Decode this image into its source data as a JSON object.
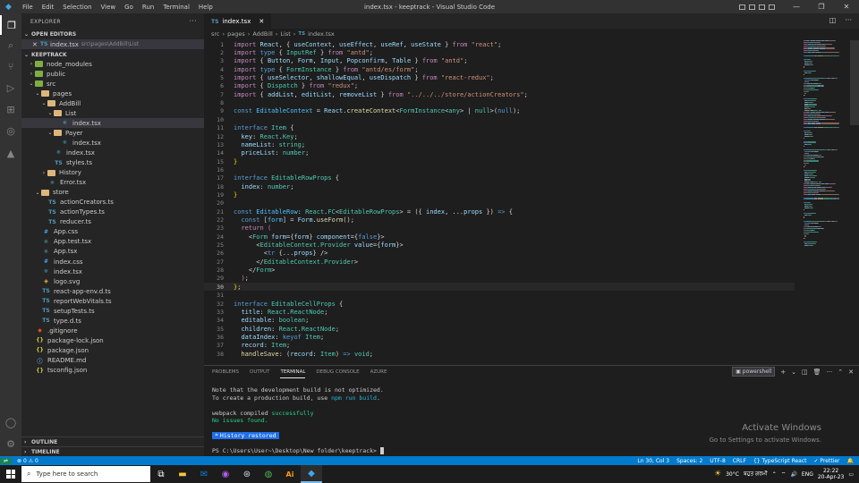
{
  "window": {
    "title": "index.tsx - keeptrack - Visual Studio Code",
    "menu": [
      "File",
      "Edit",
      "Selection",
      "View",
      "Go",
      "Run",
      "Terminal",
      "Help"
    ]
  },
  "sidebar": {
    "header": "EXPLORER",
    "open_editors_label": "OPEN EDITORS",
    "open_editor": {
      "icon": "TS",
      "name": "index.tsx",
      "path": "src\\pages\\AddBill\\List"
    },
    "project_label": "KEEPTRACK",
    "tree": [
      {
        "label": "node_modules",
        "type": "folder",
        "indent": 1,
        "open": false,
        "color": "green"
      },
      {
        "label": "public",
        "type": "folder",
        "indent": 1,
        "open": false,
        "color": "green"
      },
      {
        "label": "src",
        "type": "folder",
        "indent": 1,
        "open": true,
        "color": "green"
      },
      {
        "label": "pages",
        "type": "folder",
        "indent": 2,
        "open": true,
        "color": "orange"
      },
      {
        "label": "AddBill",
        "type": "folder",
        "indent": 3,
        "open": true,
        "color": "orange"
      },
      {
        "label": "List",
        "type": "folder",
        "indent": 4,
        "open": true,
        "color": "orange"
      },
      {
        "label": "index.tsx",
        "type": "tsx",
        "indent": 5,
        "selected": true
      },
      {
        "label": "Payer",
        "type": "folder",
        "indent": 4,
        "open": true,
        "color": "orange"
      },
      {
        "label": "index.tsx",
        "type": "tsx",
        "indent": 5
      },
      {
        "label": "index.tsx",
        "type": "tsx",
        "indent": 4
      },
      {
        "label": "styles.ts",
        "type": "ts",
        "indent": 4
      },
      {
        "label": "History",
        "type": "folder",
        "indent": 3,
        "open": false,
        "color": "orange"
      },
      {
        "label": "Error.tsx",
        "type": "tsx",
        "indent": 3
      },
      {
        "label": "store",
        "type": "folder",
        "indent": 2,
        "open": true,
        "color": "orange"
      },
      {
        "label": "actionCreators.ts",
        "type": "ts",
        "indent": 3
      },
      {
        "label": "actionTypes.ts",
        "type": "ts",
        "indent": 3
      },
      {
        "label": "reducer.ts",
        "type": "ts",
        "indent": 3
      },
      {
        "label": "App.css",
        "type": "css",
        "indent": 2
      },
      {
        "label": "App.test.tsx",
        "type": "tsx",
        "indent": 2
      },
      {
        "label": "App.tsx",
        "type": "tsx",
        "indent": 2
      },
      {
        "label": "index.css",
        "type": "css",
        "indent": 2
      },
      {
        "label": "index.tsx",
        "type": "tsx",
        "indent": 2
      },
      {
        "label": "logo.svg",
        "type": "svg",
        "indent": 2
      },
      {
        "label": "react-app-env.d.ts",
        "type": "ts",
        "indent": 2
      },
      {
        "label": "reportWebVitals.ts",
        "type": "ts",
        "indent": 2
      },
      {
        "label": "setupTests.ts",
        "type": "ts",
        "indent": 2
      },
      {
        "label": "type.d.ts",
        "type": "ts",
        "indent": 2
      },
      {
        "label": ".gitignore",
        "type": "git",
        "indent": 1
      },
      {
        "label": "package-lock.json",
        "type": "json",
        "indent": 1
      },
      {
        "label": "package.json",
        "type": "json",
        "indent": 1
      },
      {
        "label": "README.md",
        "type": "md",
        "indent": 1
      },
      {
        "label": "tsconfig.json",
        "type": "json",
        "indent": 1
      }
    ],
    "outline_label": "OUTLINE",
    "timeline_label": "TIMELINE"
  },
  "editor": {
    "tab": {
      "icon": "TS",
      "name": "index.tsx"
    },
    "breadcrumb": [
      "src",
      "pages",
      "AddBill",
      "List",
      "index.tsx"
    ],
    "breadcrumb_icon": "TS",
    "current_line": 30,
    "lines": [
      [
        [
          "k",
          "import "
        ],
        [
          "v",
          "React"
        ],
        [
          "p",
          ", { "
        ],
        [
          "v",
          "useContext"
        ],
        [
          "p",
          ", "
        ],
        [
          "v",
          "useEffect"
        ],
        [
          "p",
          ", "
        ],
        [
          "v",
          "useRef"
        ],
        [
          "p",
          ", "
        ],
        [
          "v",
          "useState"
        ],
        [
          "p",
          " } "
        ],
        [
          "k",
          "from "
        ],
        [
          "s",
          "\"react\""
        ],
        [
          "p",
          ";"
        ]
      ],
      [
        [
          "k",
          "import "
        ],
        [
          "kb",
          "type "
        ],
        [
          "p",
          "{ "
        ],
        [
          "t",
          "InputRef"
        ],
        [
          "p",
          " } "
        ],
        [
          "k",
          "from "
        ],
        [
          "s",
          "\"antd\""
        ],
        [
          "p",
          ";"
        ]
      ],
      [
        [
          "k",
          "import "
        ],
        [
          "p",
          "{ "
        ],
        [
          "v",
          "Button"
        ],
        [
          "p",
          ", "
        ],
        [
          "v",
          "Form"
        ],
        [
          "p",
          ", "
        ],
        [
          "v",
          "Input"
        ],
        [
          "p",
          ", "
        ],
        [
          "v",
          "Popconfirm"
        ],
        [
          "p",
          ", "
        ],
        [
          "v",
          "Table"
        ],
        [
          "p",
          " } "
        ],
        [
          "k",
          "from "
        ],
        [
          "s",
          "\"antd\""
        ],
        [
          "p",
          ";"
        ]
      ],
      [
        [
          "k",
          "import "
        ],
        [
          "kb",
          "type "
        ],
        [
          "p",
          "{ "
        ],
        [
          "t",
          "FormInstance"
        ],
        [
          "p",
          " } "
        ],
        [
          "k",
          "from "
        ],
        [
          "s",
          "\"antd/es/form\""
        ],
        [
          "p",
          ";"
        ]
      ],
      [
        [
          "k",
          "import "
        ],
        [
          "p",
          "{ "
        ],
        [
          "v",
          "useSelector"
        ],
        [
          "p",
          ", "
        ],
        [
          "v",
          "shallowEqual"
        ],
        [
          "p",
          ", "
        ],
        [
          "v",
          "useDispatch"
        ],
        [
          "p",
          " } "
        ],
        [
          "k",
          "from "
        ],
        [
          "s",
          "\"react-redux\""
        ],
        [
          "p",
          ";"
        ]
      ],
      [
        [
          "k",
          "import "
        ],
        [
          "p",
          "{ "
        ],
        [
          "t",
          "Dispatch"
        ],
        [
          "p",
          " } "
        ],
        [
          "k",
          "from "
        ],
        [
          "s",
          "\"redux\""
        ],
        [
          "p",
          ";"
        ]
      ],
      [
        [
          "k",
          "import "
        ],
        [
          "p",
          "{ "
        ],
        [
          "v",
          "addList"
        ],
        [
          "p",
          ", "
        ],
        [
          "v",
          "editList"
        ],
        [
          "p",
          ", "
        ],
        [
          "v",
          "removeList"
        ],
        [
          "p",
          " } "
        ],
        [
          "k",
          "from "
        ],
        [
          "s",
          "\"../../../store/actionCreators\""
        ],
        [
          "p",
          ";"
        ]
      ],
      [],
      [
        [
          "kb",
          "const "
        ],
        [
          "c",
          "EditableContext"
        ],
        [
          "p",
          " = "
        ],
        [
          "v",
          "React"
        ],
        [
          "p",
          "."
        ],
        [
          "f",
          "createContext"
        ],
        [
          "p",
          "<"
        ],
        [
          "t",
          "FormInstance"
        ],
        [
          "p",
          "<"
        ],
        [
          "t",
          "any"
        ],
        [
          "p",
          "> | "
        ],
        [
          "t",
          "null"
        ],
        [
          "p",
          ">("
        ],
        [
          "kb",
          "null"
        ],
        [
          "p",
          ");"
        ]
      ],
      [],
      [
        [
          "kb",
          "interface "
        ],
        [
          "t",
          "Item"
        ],
        [
          "p",
          " {"
        ]
      ],
      [
        [
          "p",
          "  "
        ],
        [
          "v",
          "key"
        ],
        [
          "p",
          ": "
        ],
        [
          "t",
          "React"
        ],
        [
          "p",
          "."
        ],
        [
          "t",
          "Key"
        ],
        [
          "p",
          ";"
        ]
      ],
      [
        [
          "p",
          "  "
        ],
        [
          "v",
          "nameList"
        ],
        [
          "p",
          ": "
        ],
        [
          "t",
          "string"
        ],
        [
          "p",
          ";"
        ]
      ],
      [
        [
          "p",
          "  "
        ],
        [
          "v",
          "priceList"
        ],
        [
          "p",
          ": "
        ],
        [
          "t",
          "number"
        ],
        [
          "p",
          ";"
        ]
      ],
      [
        [
          "br",
          "}"
        ]
      ],
      [],
      [
        [
          "kb",
          "interface "
        ],
        [
          "t",
          "EditableRowProps"
        ],
        [
          "p",
          " {"
        ]
      ],
      [
        [
          "p",
          "  "
        ],
        [
          "v",
          "index"
        ],
        [
          "p",
          ": "
        ],
        [
          "t",
          "number"
        ],
        [
          "p",
          ";"
        ]
      ],
      [
        [
          "br",
          "}"
        ]
      ],
      [],
      [
        [
          "kb",
          "const "
        ],
        [
          "c",
          "EditableRow"
        ],
        [
          "p",
          ": "
        ],
        [
          "t",
          "React"
        ],
        [
          "p",
          "."
        ],
        [
          "t",
          "FC"
        ],
        [
          "p",
          "<"
        ],
        [
          "t",
          "EditableRowProps"
        ],
        [
          "p",
          "> = ({ "
        ],
        [
          "v",
          "index"
        ],
        [
          "p",
          ", ..."
        ],
        [
          "v",
          "props"
        ],
        [
          "p",
          " }) "
        ],
        [
          "kb",
          "=>"
        ],
        [
          "p",
          " {"
        ]
      ],
      [
        [
          "p",
          "  "
        ],
        [
          "kb",
          "const "
        ],
        [
          "p",
          "["
        ],
        [
          "c",
          "form"
        ],
        [
          "p",
          "] = "
        ],
        [
          "v",
          "Form"
        ],
        [
          "p",
          "."
        ],
        [
          "f",
          "useForm"
        ],
        [
          "p",
          "();"
        ]
      ],
      [
        [
          "p",
          "  "
        ],
        [
          "k",
          "return "
        ],
        [
          "br2",
          "("
        ]
      ],
      [
        [
          "p",
          "    <"
        ],
        [
          "tag",
          "Form "
        ],
        [
          "v",
          "form"
        ],
        [
          "p",
          "={"
        ],
        [
          "v",
          "form"
        ],
        [
          "p",
          "} "
        ],
        [
          "v",
          "component"
        ],
        [
          "p",
          "={"
        ],
        [
          "kb",
          "false"
        ],
        [
          "p",
          "}>"
        ]
      ],
      [
        [
          "p",
          "      <"
        ],
        [
          "tag",
          "EditableContext.Provider "
        ],
        [
          "v",
          "value"
        ],
        [
          "p",
          "={"
        ],
        [
          "v",
          "form"
        ],
        [
          "p",
          "}>"
        ]
      ],
      [
        [
          "p",
          "        <"
        ],
        [
          "kb",
          "tr "
        ],
        [
          "p",
          "{..."
        ],
        [
          "v",
          "props"
        ],
        [
          "p",
          "} />"
        ]
      ],
      [
        [
          "p",
          "      </"
        ],
        [
          "tag",
          "EditableContext.Provider"
        ],
        [
          "p",
          ">"
        ]
      ],
      [
        [
          "p",
          "    </"
        ],
        [
          "tag",
          "Form"
        ],
        [
          "p",
          ">"
        ]
      ],
      [
        [
          "p",
          "  "
        ],
        [
          "br2",
          ")"
        ],
        [
          "p",
          ";"
        ]
      ],
      [
        [
          "br",
          "}"
        ],
        [
          "p",
          ";"
        ]
      ],
      [],
      [
        [
          "kb",
          "interface "
        ],
        [
          "t",
          "EditableCellProps"
        ],
        [
          "p",
          " {"
        ]
      ],
      [
        [
          "p",
          "  "
        ],
        [
          "v",
          "title"
        ],
        [
          "p",
          ": "
        ],
        [
          "t",
          "React"
        ],
        [
          "p",
          "."
        ],
        [
          "t",
          "ReactNode"
        ],
        [
          "p",
          ";"
        ]
      ],
      [
        [
          "p",
          "  "
        ],
        [
          "v",
          "editable"
        ],
        [
          "p",
          ": "
        ],
        [
          "t",
          "boolean"
        ],
        [
          "p",
          ";"
        ]
      ],
      [
        [
          "p",
          "  "
        ],
        [
          "v",
          "children"
        ],
        [
          "p",
          ": "
        ],
        [
          "t",
          "React"
        ],
        [
          "p",
          "."
        ],
        [
          "t",
          "ReactNode"
        ],
        [
          "p",
          ";"
        ]
      ],
      [
        [
          "p",
          "  "
        ],
        [
          "v",
          "dataIndex"
        ],
        [
          "p",
          ": "
        ],
        [
          "kb",
          "keyof "
        ],
        [
          "t",
          "Item"
        ],
        [
          "p",
          ";"
        ]
      ],
      [
        [
          "p",
          "  "
        ],
        [
          "v",
          "record"
        ],
        [
          "p",
          ": "
        ],
        [
          "t",
          "Item"
        ],
        [
          "p",
          ";"
        ]
      ],
      [
        [
          "p",
          "  "
        ],
        [
          "f",
          "handleSave"
        ],
        [
          "p",
          ": ("
        ],
        [
          "v",
          "record"
        ],
        [
          "p",
          ": "
        ],
        [
          "t",
          "Item"
        ],
        [
          "p",
          ") "
        ],
        [
          "kb",
          "=>"
        ],
        [
          "p",
          " "
        ],
        [
          "t",
          "void"
        ],
        [
          "p",
          ";"
        ]
      ]
    ]
  },
  "panel": {
    "tabs": [
      "PROBLEMS",
      "OUTPUT",
      "TERMINAL",
      "DEBUG CONSOLE",
      "AZURE"
    ],
    "active_tab": "TERMINAL",
    "shell": "powershell",
    "terminal": {
      "line1": "Note that the development build is not optimized.",
      "line2_a": "To create a production build, use ",
      "line2_b": "npm run build",
      "line2_c": ".",
      "line3_a": "webpack compiled ",
      "line3_b": "successfully",
      "line4": "No issues found.",
      "history_star": "*",
      "history_label": "History restored",
      "prompt": "PS C:\\Users\\User~\\Desktop\\New folder\\keeptrack> "
    },
    "activate_title": "Activate Windows",
    "activate_sub": "Go to Settings to activate Windows."
  },
  "statusbar": {
    "errors": "0",
    "warnings": "0",
    "position": "Ln 30, Col 3",
    "spaces": "Spaces: 2",
    "encoding": "UTF-8",
    "eol": "CRLF",
    "language": "{} TypeScript React",
    "prettier": "✓ Prettier"
  },
  "taskbar": {
    "search_placeholder": "Type here to search",
    "weather": "30°C",
    "weather_desc": "ਬਹੁਤ ਗਰਮੀ",
    "lang": "ENG",
    "time": "22:22",
    "date": "20-Apr-23"
  },
  "colors": {
    "accent": "#007acc",
    "background": "#1e1e1e",
    "sidebar": "#252526",
    "activitybar": "#333333"
  }
}
